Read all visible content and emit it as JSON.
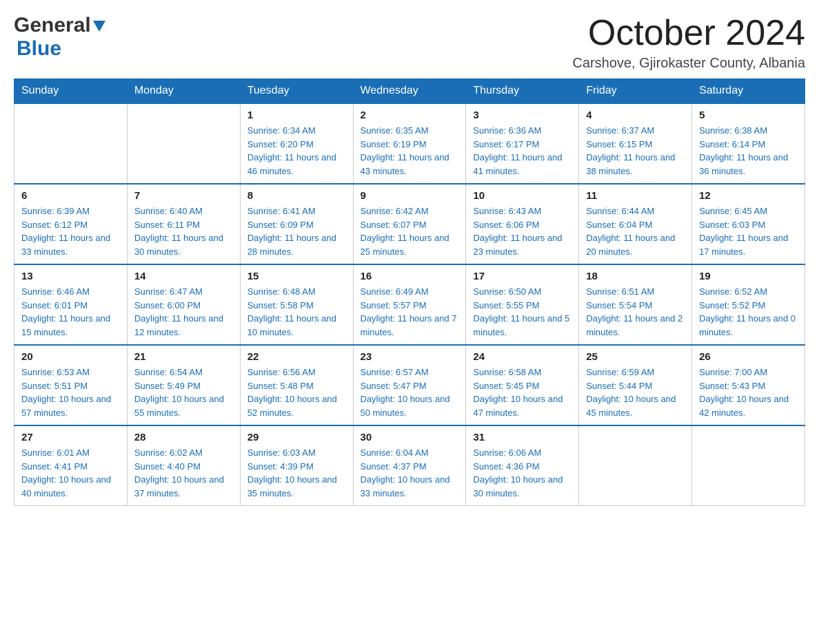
{
  "logo": {
    "general": "General",
    "blue": "Blue"
  },
  "header": {
    "month": "October 2024",
    "location": "Carshove, Gjirokaster County, Albania"
  },
  "days_of_week": [
    "Sunday",
    "Monday",
    "Tuesday",
    "Wednesday",
    "Thursday",
    "Friday",
    "Saturday"
  ],
  "weeks": [
    [
      {
        "day": "",
        "sunrise": "",
        "sunset": "",
        "daylight": ""
      },
      {
        "day": "",
        "sunrise": "",
        "sunset": "",
        "daylight": ""
      },
      {
        "day": "1",
        "sunrise": "Sunrise: 6:34 AM",
        "sunset": "Sunset: 6:20 PM",
        "daylight": "Daylight: 11 hours and 46 minutes."
      },
      {
        "day": "2",
        "sunrise": "Sunrise: 6:35 AM",
        "sunset": "Sunset: 6:19 PM",
        "daylight": "Daylight: 11 hours and 43 minutes."
      },
      {
        "day": "3",
        "sunrise": "Sunrise: 6:36 AM",
        "sunset": "Sunset: 6:17 PM",
        "daylight": "Daylight: 11 hours and 41 minutes."
      },
      {
        "day": "4",
        "sunrise": "Sunrise: 6:37 AM",
        "sunset": "Sunset: 6:15 PM",
        "daylight": "Daylight: 11 hours and 38 minutes."
      },
      {
        "day": "5",
        "sunrise": "Sunrise: 6:38 AM",
        "sunset": "Sunset: 6:14 PM",
        "daylight": "Daylight: 11 hours and 36 minutes."
      }
    ],
    [
      {
        "day": "6",
        "sunrise": "Sunrise: 6:39 AM",
        "sunset": "Sunset: 6:12 PM",
        "daylight": "Daylight: 11 hours and 33 minutes."
      },
      {
        "day": "7",
        "sunrise": "Sunrise: 6:40 AM",
        "sunset": "Sunset: 6:11 PM",
        "daylight": "Daylight: 11 hours and 30 minutes."
      },
      {
        "day": "8",
        "sunrise": "Sunrise: 6:41 AM",
        "sunset": "Sunset: 6:09 PM",
        "daylight": "Daylight: 11 hours and 28 minutes."
      },
      {
        "day": "9",
        "sunrise": "Sunrise: 6:42 AM",
        "sunset": "Sunset: 6:07 PM",
        "daylight": "Daylight: 11 hours and 25 minutes."
      },
      {
        "day": "10",
        "sunrise": "Sunrise: 6:43 AM",
        "sunset": "Sunset: 6:06 PM",
        "daylight": "Daylight: 11 hours and 23 minutes."
      },
      {
        "day": "11",
        "sunrise": "Sunrise: 6:44 AM",
        "sunset": "Sunset: 6:04 PM",
        "daylight": "Daylight: 11 hours and 20 minutes."
      },
      {
        "day": "12",
        "sunrise": "Sunrise: 6:45 AM",
        "sunset": "Sunset: 6:03 PM",
        "daylight": "Daylight: 11 hours and 17 minutes."
      }
    ],
    [
      {
        "day": "13",
        "sunrise": "Sunrise: 6:46 AM",
        "sunset": "Sunset: 6:01 PM",
        "daylight": "Daylight: 11 hours and 15 minutes."
      },
      {
        "day": "14",
        "sunrise": "Sunrise: 6:47 AM",
        "sunset": "Sunset: 6:00 PM",
        "daylight": "Daylight: 11 hours and 12 minutes."
      },
      {
        "day": "15",
        "sunrise": "Sunrise: 6:48 AM",
        "sunset": "Sunset: 5:58 PM",
        "daylight": "Daylight: 11 hours and 10 minutes."
      },
      {
        "day": "16",
        "sunrise": "Sunrise: 6:49 AM",
        "sunset": "Sunset: 5:57 PM",
        "daylight": "Daylight: 11 hours and 7 minutes."
      },
      {
        "day": "17",
        "sunrise": "Sunrise: 6:50 AM",
        "sunset": "Sunset: 5:55 PM",
        "daylight": "Daylight: 11 hours and 5 minutes."
      },
      {
        "day": "18",
        "sunrise": "Sunrise: 6:51 AM",
        "sunset": "Sunset: 5:54 PM",
        "daylight": "Daylight: 11 hours and 2 minutes."
      },
      {
        "day": "19",
        "sunrise": "Sunrise: 6:52 AM",
        "sunset": "Sunset: 5:52 PM",
        "daylight": "Daylight: 11 hours and 0 minutes."
      }
    ],
    [
      {
        "day": "20",
        "sunrise": "Sunrise: 6:53 AM",
        "sunset": "Sunset: 5:51 PM",
        "daylight": "Daylight: 10 hours and 57 minutes."
      },
      {
        "day": "21",
        "sunrise": "Sunrise: 6:54 AM",
        "sunset": "Sunset: 5:49 PM",
        "daylight": "Daylight: 10 hours and 55 minutes."
      },
      {
        "day": "22",
        "sunrise": "Sunrise: 6:56 AM",
        "sunset": "Sunset: 5:48 PM",
        "daylight": "Daylight: 10 hours and 52 minutes."
      },
      {
        "day": "23",
        "sunrise": "Sunrise: 6:57 AM",
        "sunset": "Sunset: 5:47 PM",
        "daylight": "Daylight: 10 hours and 50 minutes."
      },
      {
        "day": "24",
        "sunrise": "Sunrise: 6:58 AM",
        "sunset": "Sunset: 5:45 PM",
        "daylight": "Daylight: 10 hours and 47 minutes."
      },
      {
        "day": "25",
        "sunrise": "Sunrise: 6:59 AM",
        "sunset": "Sunset: 5:44 PM",
        "daylight": "Daylight: 10 hours and 45 minutes."
      },
      {
        "day": "26",
        "sunrise": "Sunrise: 7:00 AM",
        "sunset": "Sunset: 5:43 PM",
        "daylight": "Daylight: 10 hours and 42 minutes."
      }
    ],
    [
      {
        "day": "27",
        "sunrise": "Sunrise: 6:01 AM",
        "sunset": "Sunset: 4:41 PM",
        "daylight": "Daylight: 10 hours and 40 minutes."
      },
      {
        "day": "28",
        "sunrise": "Sunrise: 6:02 AM",
        "sunset": "Sunset: 4:40 PM",
        "daylight": "Daylight: 10 hours and 37 minutes."
      },
      {
        "day": "29",
        "sunrise": "Sunrise: 6:03 AM",
        "sunset": "Sunset: 4:39 PM",
        "daylight": "Daylight: 10 hours and 35 minutes."
      },
      {
        "day": "30",
        "sunrise": "Sunrise: 6:04 AM",
        "sunset": "Sunset: 4:37 PM",
        "daylight": "Daylight: 10 hours and 33 minutes."
      },
      {
        "day": "31",
        "sunrise": "Sunrise: 6:06 AM",
        "sunset": "Sunset: 4:36 PM",
        "daylight": "Daylight: 10 hours and 30 minutes."
      },
      {
        "day": "",
        "sunrise": "",
        "sunset": "",
        "daylight": ""
      },
      {
        "day": "",
        "sunrise": "",
        "sunset": "",
        "daylight": ""
      }
    ]
  ]
}
